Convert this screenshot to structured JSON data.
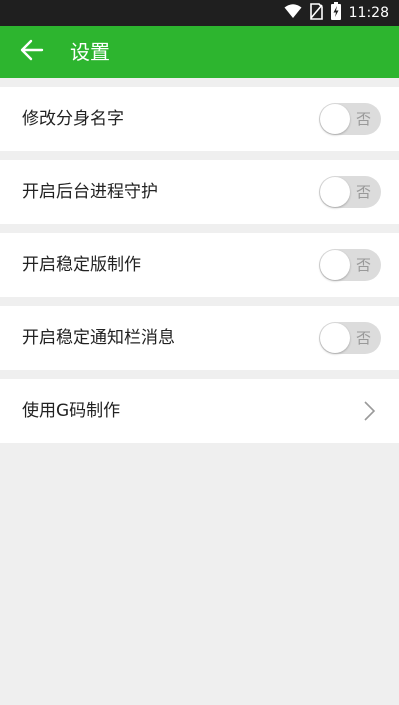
{
  "status_bar": {
    "time": "11:28",
    "icons": [
      "wifi-icon",
      "no-sim-icon",
      "battery-charging-icon"
    ]
  },
  "app_bar": {
    "title": "设置",
    "back_icon": "arrow-left-icon"
  },
  "settings": {
    "items": [
      {
        "label": "修改分身名字",
        "type": "toggle",
        "state": "否"
      },
      {
        "label": "开启后台进程守护",
        "type": "toggle",
        "state": "否"
      },
      {
        "label": "开启稳定版制作",
        "type": "toggle",
        "state": "否"
      },
      {
        "label": "开启稳定通知栏消息",
        "type": "toggle",
        "state": "否"
      },
      {
        "label": "使用G码制作",
        "type": "link",
        "icon": "chevron-right-icon"
      }
    ]
  },
  "colors": {
    "accent": "#2db52f",
    "status_bar": "#1f1f1f",
    "background": "#efefef",
    "toggle_off": "#dcdcdc"
  }
}
